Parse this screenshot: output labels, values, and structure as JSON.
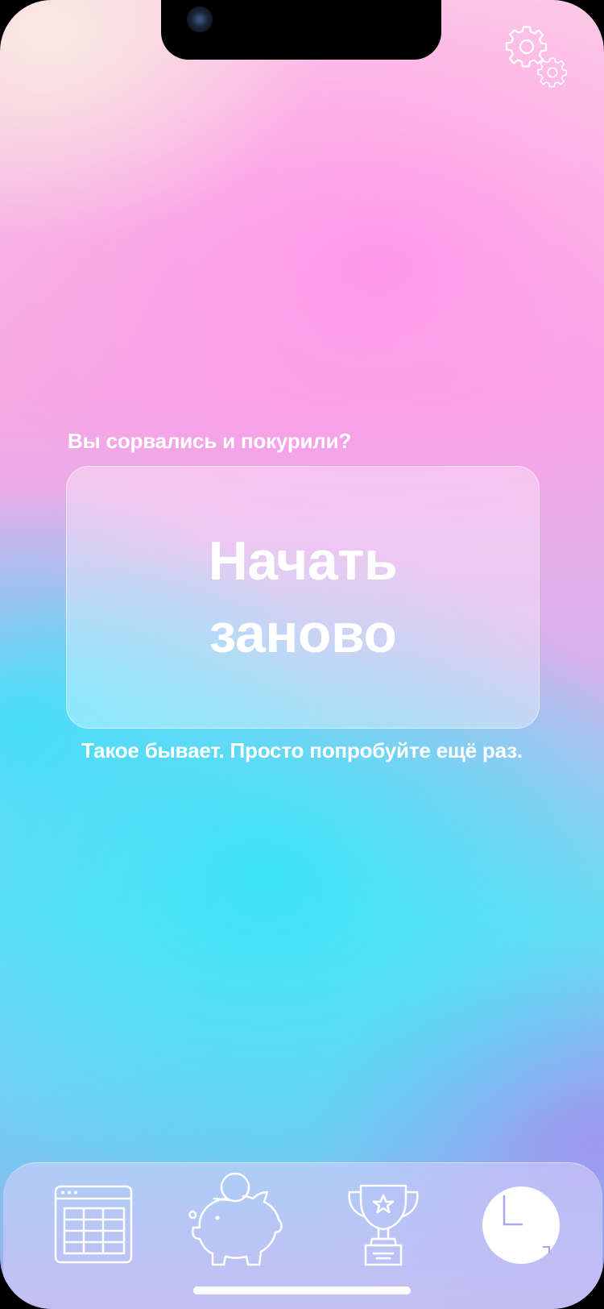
{
  "restart": {
    "prompt": "Вы сорвались и покурили?",
    "button_label": "Начать заново",
    "hint": "Такое бывает. Просто попробуйте ещё раз."
  },
  "icons": {
    "settings": "gears-icon",
    "tabs": [
      "calendar-table-icon",
      "piggy-bank-icon",
      "trophy-icon",
      "clock-icon"
    ]
  },
  "colors": {
    "text": "#ffffff",
    "gradient_top": "#f6a8e4",
    "gradient_bottom": "#48e0f6"
  }
}
